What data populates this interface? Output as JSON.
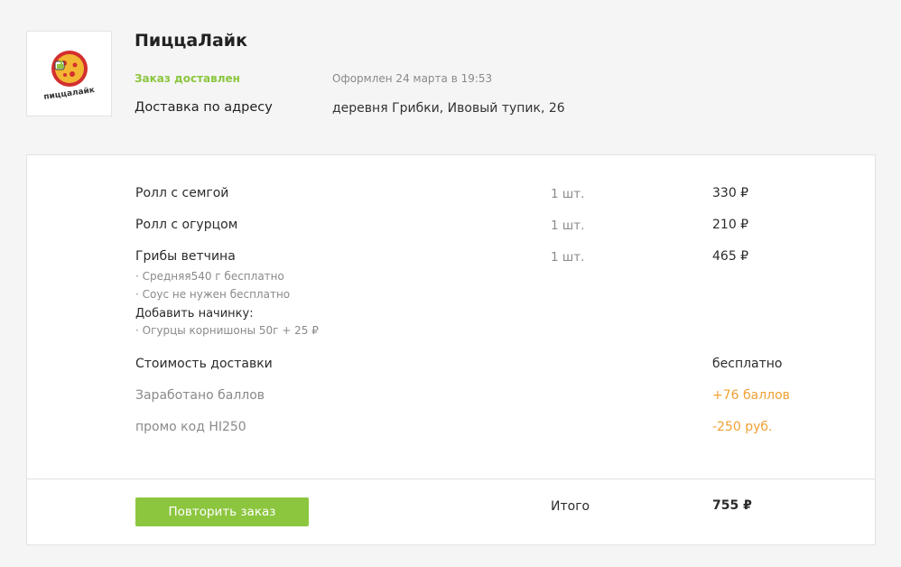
{
  "restaurant": {
    "name": "ПиццаЛайк",
    "logo_text": "пиццалайк"
  },
  "order": {
    "status": "Заказ доставлен",
    "date": "Оформлен 24 марта в 19:53",
    "delivery_label": "Доставка по адресу",
    "delivery_address": "деревня Грибки, Ивовый тупик, 26"
  },
  "items": [
    {
      "name": "Ролл с семгой",
      "qty": "1 шт.",
      "price": "330 ₽"
    },
    {
      "name": "Ролл с огурцом",
      "qty": "1 шт.",
      "price": "210 ₽"
    },
    {
      "name": "Грибы ветчина",
      "qty": "1 шт.",
      "price": "465 ₽",
      "options": [
        "· Средняя540 г бесплатно",
        "· Соус не нужен бесплатно"
      ],
      "addon_header": "Добавить начинку:",
      "addons": [
        "· Огурцы корнишоны 50г + 25 ₽"
      ]
    }
  ],
  "summary": {
    "delivery_cost_label": "Стоимость доставки",
    "delivery_cost_value": "бесплатно",
    "points_label": "Заработано баллов",
    "points_value": "+76 баллов",
    "promo_label": "промо код HI250",
    "promo_value": "-250 руб."
  },
  "footer": {
    "repeat_button": "Повторить заказ",
    "total_label": "Итого",
    "total_value": "755 ₽"
  },
  "colors": {
    "accent_green": "#8cc63f",
    "accent_orange": "#f0a033",
    "logo_red": "#d32f2f",
    "logo_yellow": "#f2b632"
  }
}
